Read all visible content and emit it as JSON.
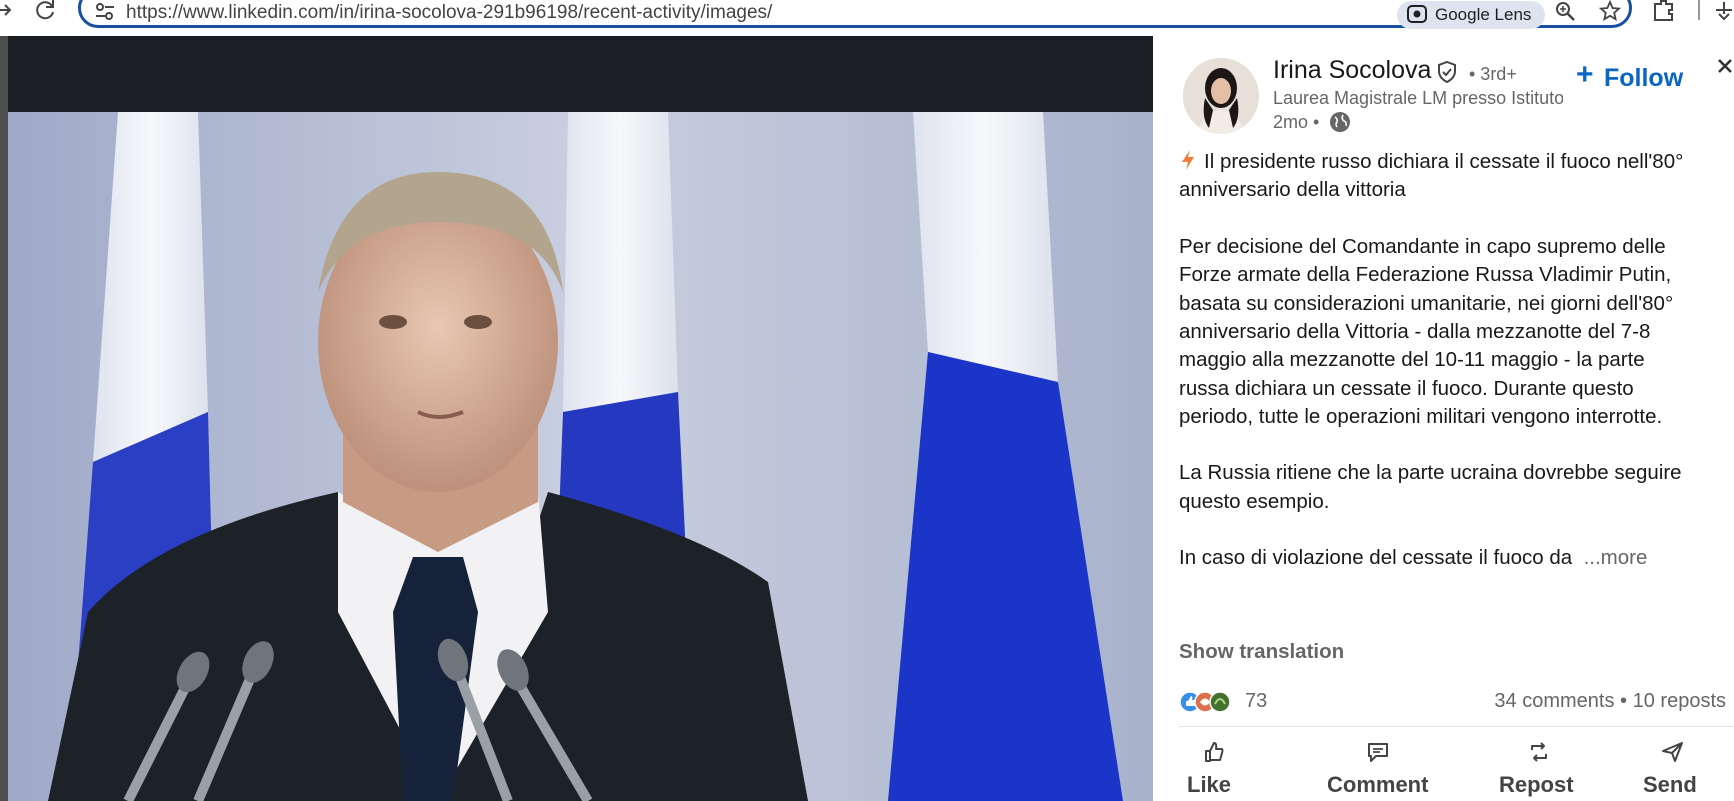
{
  "browser": {
    "url": "https://www.linkedin.com/in/irina-socolova-291b96198/recent-activity/images/",
    "lens_label": "Google Lens"
  },
  "post": {
    "author_name": "Irina Socolova",
    "degree": "• 3rd+",
    "headline": "Laurea Magistrale LM presso Istituto Universitario...",
    "time_ago": "2mo •",
    "follow_label": "Follow",
    "lines": [
      "Il presidente russo dichiara il cessate il fuoco nell'80°",
      "anniversario della vittoria",
      "Per decisione del Comandante in capo supremo delle",
      "Forze armate della Federazione Russa Vladimir Putin,",
      "basata su considerazioni umanitarie, nei giorni dell'80°",
      "anniversario della Vittoria - dalla mezzanotte del 7-8",
      "maggio alla mezzanotte del 10-11 maggio - la parte",
      "russa dichiara un cessate il fuoco. Durante questo",
      "periodo, tutte le operazioni militari vengono interrotte.",
      "La Russia ritiene che la parte ucraina dovrebbe seguire",
      "questo esempio.",
      "In caso di violazione del cessate il fuoco da"
    ],
    "more_label": "...more",
    "show_translation": "Show translation",
    "reactions_count": "73",
    "comments": "34 comments",
    "separator": "•",
    "reposts": "10 reposts"
  },
  "actions": {
    "like": "Like",
    "comment": "Comment",
    "repost": "Repost",
    "send": "Send"
  },
  "colors": {
    "linkedin_blue": "#0a66c2",
    "omnibox_border": "#1a4fa0",
    "image_frame": "#1b1f23",
    "flag_blue": "#1c35c9"
  },
  "icons": [
    "forward-icon",
    "reload-icon",
    "site-settings-icon",
    "google-lens-icon",
    "zoom-icon",
    "bookmark-star-icon",
    "extensions-icon",
    "profile-icon",
    "verified-icon",
    "globe-icon",
    "close-icon",
    "lightning-icon",
    "like-icon",
    "comment-icon",
    "repost-icon",
    "send-icon"
  ]
}
